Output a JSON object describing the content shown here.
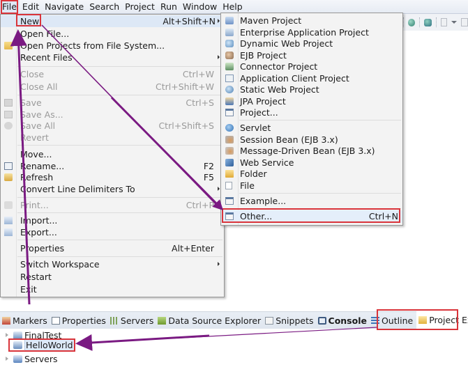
{
  "menubar": {
    "items": [
      {
        "label": "File",
        "mnemonic": "F"
      },
      {
        "label": "Edit",
        "mnemonic": "E"
      },
      {
        "label": "Navigate",
        "mnemonic": "N"
      },
      {
        "label": "Search",
        "mnemonic": "a"
      },
      {
        "label": "Project",
        "mnemonic": "P"
      },
      {
        "label": "Run",
        "mnemonic": "R"
      },
      {
        "label": "Window",
        "mnemonic": "W"
      },
      {
        "label": "Help",
        "mnemonic": "H"
      }
    ]
  },
  "file_menu": {
    "items": [
      {
        "label": "New",
        "shortcut": "Alt+Shift+N",
        "submenu": true,
        "icon": "",
        "enabled": true
      },
      {
        "label": "Open File...",
        "shortcut": "",
        "icon": "",
        "enabled": true
      },
      {
        "label": "Open Projects from File System...",
        "shortcut": "",
        "icon": "folder-open-icon",
        "enabled": true
      },
      {
        "label": "Recent Files",
        "shortcut": "",
        "submenu": true,
        "icon": "",
        "enabled": true
      },
      {
        "label": "Close",
        "shortcut": "Ctrl+W",
        "icon": "",
        "enabled": false
      },
      {
        "label": "Close All",
        "shortcut": "Ctrl+Shift+W",
        "icon": "",
        "enabled": false
      },
      {
        "label": "Save",
        "shortcut": "Ctrl+S",
        "icon": "save-icon",
        "enabled": false
      },
      {
        "label": "Save As...",
        "shortcut": "",
        "icon": "save-as-icon",
        "enabled": false
      },
      {
        "label": "Save All",
        "shortcut": "Ctrl+Shift+S",
        "icon": "save-all-icon",
        "enabled": false
      },
      {
        "label": "Revert",
        "shortcut": "",
        "icon": "",
        "enabled": false
      },
      {
        "label": "Move...",
        "shortcut": "",
        "icon": "",
        "enabled": true
      },
      {
        "label": "Rename...",
        "shortcut": "F2",
        "icon": "rename-icon",
        "enabled": true
      },
      {
        "label": "Refresh",
        "shortcut": "F5",
        "icon": "refresh-icon",
        "enabled": true
      },
      {
        "label": "Convert Line Delimiters To",
        "shortcut": "",
        "submenu": true,
        "icon": "",
        "enabled": true
      },
      {
        "label": "Print...",
        "shortcut": "Ctrl+P",
        "icon": "print-icon",
        "enabled": false
      },
      {
        "label": "Import...",
        "shortcut": "",
        "icon": "import-icon",
        "enabled": true
      },
      {
        "label": "Export...",
        "shortcut": "",
        "icon": "export-icon",
        "enabled": true
      },
      {
        "label": "Properties",
        "shortcut": "Alt+Enter",
        "icon": "",
        "enabled": true
      },
      {
        "label": "Switch Workspace",
        "shortcut": "",
        "submenu": true,
        "icon": "",
        "enabled": true
      },
      {
        "label": "Restart",
        "shortcut": "",
        "icon": "",
        "enabled": true
      },
      {
        "label": "Exit",
        "shortcut": "",
        "icon": "",
        "enabled": true
      }
    ]
  },
  "new_submenu": {
    "items": [
      {
        "label": "Maven Project",
        "icon": "maven-project-icon",
        "shortcut": ""
      },
      {
        "label": "Enterprise Application Project",
        "icon": "enterprise-app-project-icon",
        "shortcut": ""
      },
      {
        "label": "Dynamic Web Project",
        "icon": "dynamic-web-project-icon",
        "shortcut": ""
      },
      {
        "label": "EJB Project",
        "icon": "ejb-project-icon",
        "shortcut": ""
      },
      {
        "label": "Connector Project",
        "icon": "connector-project-icon",
        "shortcut": ""
      },
      {
        "label": "Application Client Project",
        "icon": "app-client-project-icon",
        "shortcut": ""
      },
      {
        "label": "Static Web Project",
        "icon": "static-web-project-icon",
        "shortcut": ""
      },
      {
        "label": "JPA Project",
        "icon": "jpa-project-icon",
        "shortcut": ""
      },
      {
        "label": "Project...",
        "icon": "project-icon",
        "shortcut": ""
      },
      {
        "label": "Servlet",
        "icon": "servlet-icon",
        "shortcut": ""
      },
      {
        "label": "Session Bean (EJB 3.x)",
        "icon": "session-bean-icon",
        "shortcut": ""
      },
      {
        "label": "Message-Driven Bean (EJB 3.x)",
        "icon": "message-driven-bean-icon",
        "shortcut": ""
      },
      {
        "label": "Web Service",
        "icon": "web-service-icon",
        "shortcut": ""
      },
      {
        "label": "Folder",
        "icon": "folder-icon",
        "shortcut": ""
      },
      {
        "label": "File",
        "icon": "file-icon",
        "shortcut": ""
      },
      {
        "label": "Example...",
        "icon": "example-icon",
        "shortcut": ""
      },
      {
        "label": "Other...",
        "icon": "other-wizard-icon",
        "shortcut": "Ctrl+N"
      }
    ]
  },
  "view_tabs": [
    {
      "label": "Markers",
      "icon": "markers-icon"
    },
    {
      "label": "Properties",
      "icon": "properties-icon"
    },
    {
      "label": "Servers",
      "icon": "servers-icon"
    },
    {
      "label": "Data Source Explorer",
      "icon": "data-source-explorer-icon"
    },
    {
      "label": "Snippets",
      "icon": "snippets-icon"
    },
    {
      "label": "Console",
      "icon": "console-icon",
      "bold": true
    },
    {
      "label": "Outline",
      "icon": "outline-icon"
    },
    {
      "label": "Project Explorer",
      "icon": "project-explorer-icon",
      "active": true,
      "close": "⊗"
    }
  ],
  "project_tree": [
    {
      "label": "FinalTest",
      "icon": "project-icon",
      "expandable": true
    },
    {
      "label": "HelloWorld",
      "icon": "project-icon",
      "expandable": false,
      "selected": true
    },
    {
      "label": "Servers",
      "icon": "folder-icon",
      "expandable": true
    }
  ],
  "annotation": {
    "highlight_color": "#d9343a",
    "arrow_color": "#7a1a82"
  }
}
